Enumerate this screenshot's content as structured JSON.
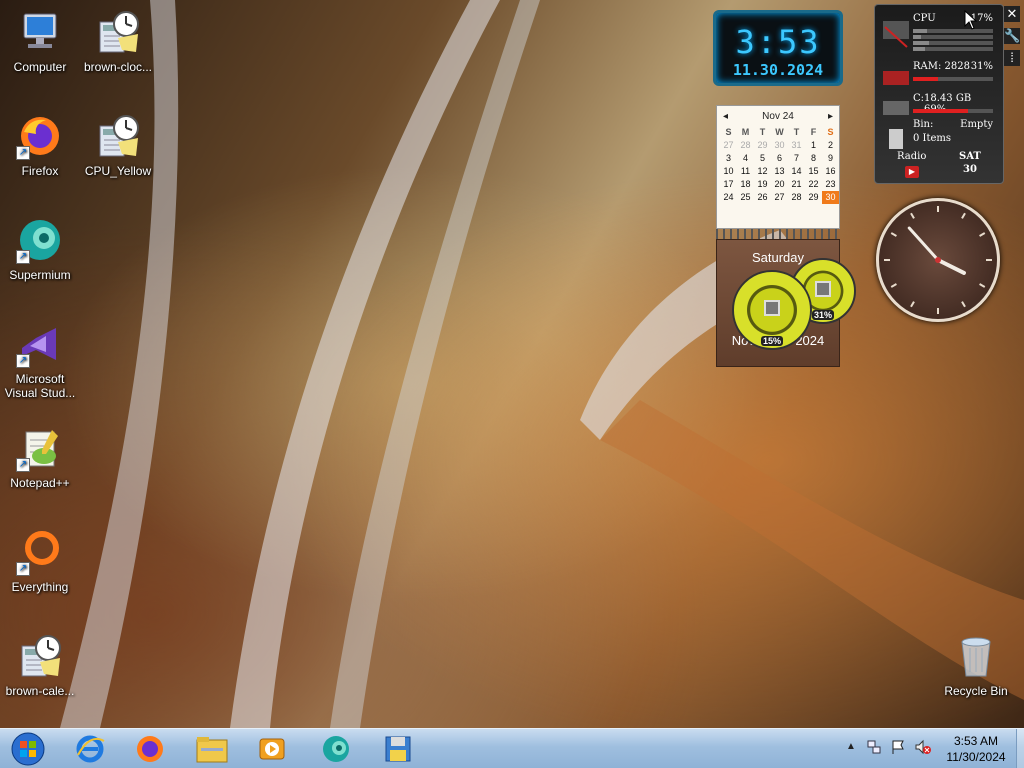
{
  "desktop": {
    "icons_left": [
      {
        "label": "Computer",
        "icon": "computer-icon"
      },
      {
        "label": "Firefox",
        "icon": "firefox-icon"
      },
      {
        "label": "Supermium",
        "icon": "supermium-icon"
      },
      {
        "label": "Microsoft Visual Stud...",
        "icon": "visual-studio-icon"
      },
      {
        "label": "Notepad++",
        "icon": "notepad-plus-plus-icon"
      },
      {
        "label": "Everything",
        "icon": "everything-icon"
      },
      {
        "label": "brown-cale...",
        "icon": "calendar-gadget-file-icon"
      }
    ],
    "icons_second_col": [
      {
        "label": "brown-cloc...",
        "icon": "clock-gadget-file-icon"
      },
      {
        "label": "CPU_Yellow",
        "icon": "clock-gadget-file-icon"
      }
    ],
    "recycle_bin": {
      "label": "Recycle Bin",
      "icon": "recycle-bin-icon"
    }
  },
  "gadgets": {
    "digital_clock": {
      "time": "3:53",
      "date": "11.30.2024"
    },
    "calendar": {
      "month_label": "Nov 24",
      "weekday_headers": [
        "S",
        "M",
        "T",
        "W",
        "T",
        "F",
        "S"
      ],
      "days": [
        "27",
        "28",
        "29",
        "30",
        "31",
        "1",
        "2",
        "3",
        "4",
        "5",
        "6",
        "7",
        "8",
        "9",
        "10",
        "11",
        "12",
        "13",
        "14",
        "15",
        "16",
        "17",
        "18",
        "19",
        "20",
        "21",
        "22",
        "23",
        "24",
        "25",
        "26",
        "27",
        "28",
        "29",
        "30"
      ],
      "today": "30",
      "day_name": "Saturday",
      "month_year": "November 2024"
    },
    "cpu_meter": {
      "cpu1_pct": "15%",
      "cpu2_pct": "31%"
    },
    "system_monitor": {
      "cpu_label": "CPU",
      "cpu_value": "17%",
      "ram_label": "RAM: 2828",
      "ram_value": "31%",
      "disk_label": "C:",
      "disk_value": "18.43 GB 69%",
      "bin_label": "Bin:",
      "bin_value": "Empty",
      "bin_items": "0 Items",
      "radio_label": "Radio",
      "day_abbrev": "SAT",
      "day_number": "30"
    },
    "analog_clock": {
      "hour": 3,
      "minute": 53
    }
  },
  "taskbar": {
    "start": "start-orb-icon",
    "pinned": [
      "internet-explorer-icon",
      "firefox-icon",
      "file-explorer-icon",
      "media-player-icon",
      "supermium-icon",
      "floppy-icon"
    ],
    "tray_icons": [
      "show-hidden-icons-icon",
      "network-icon",
      "action-center-flag-icon",
      "volume-muted-icon"
    ],
    "time": "3:53 AM",
    "date": "11/30/2024"
  },
  "colors": {
    "accent_cyan": "#3cc8ff",
    "calendar_today": "#f07a1a",
    "sysmon_bar": "#e02020"
  }
}
